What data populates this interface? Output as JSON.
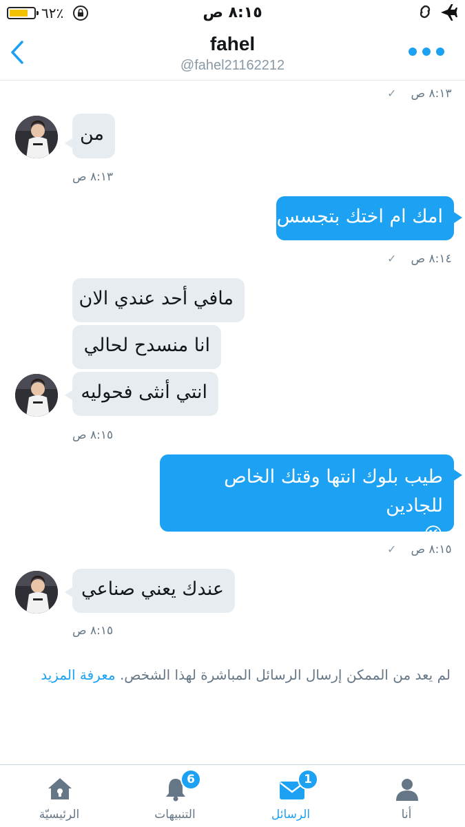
{
  "status_bar": {
    "time": "٨:١٥ ص",
    "battery": "٪٦٢",
    "battery_level": 0.62
  },
  "header": {
    "name": "fahel",
    "handle": "@fahel21162212"
  },
  "messages": [
    {
      "side": "out-status",
      "time": "٨:١٣ ص"
    },
    {
      "side": "in",
      "text": "من",
      "time": "٨:١٣ ص"
    },
    {
      "side": "out",
      "text": "امك ام اختك بتجسس",
      "time": "٨:١٤ ص"
    },
    {
      "side": "in",
      "group": [
        "مافي أحد عندي الان",
        "انا منسدح لحالي",
        "انتي أنثى فحوليه"
      ],
      "time": "٨:١٥ ص"
    },
    {
      "side": "out",
      "text": "طيب بلوك انتها وقتك الخاص للجادين",
      "emoji": "😘",
      "time": "٨:١٥ ص"
    },
    {
      "side": "in",
      "text": "عندك يعني صناعي",
      "time": "٨:١٥ ص"
    }
  ],
  "notice": {
    "text": "لم يعد من الممكن إرسال الرسائل المباشرة لهذا الشخص.",
    "link": "معرفة المزيد"
  },
  "tabs": [
    {
      "label": "الرئيسيّة",
      "icon": "home-icon"
    },
    {
      "label": "التنبيهات",
      "icon": "bell-icon",
      "badge": "6"
    },
    {
      "label": "الرسائل",
      "icon": "envelope-icon",
      "badge": "1",
      "active": true
    },
    {
      "label": "أنا",
      "icon": "person-icon"
    }
  ],
  "colors": {
    "accent": "#1da1f2",
    "incoming_bubble": "#e6ecf0",
    "muted_text": "#657786"
  }
}
